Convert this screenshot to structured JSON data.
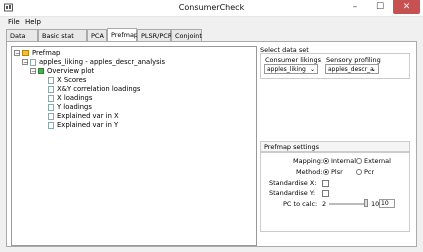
{
  "window": {
    "title": "ConsumerCheck",
    "minimize": "–",
    "maximize": "☐",
    "close": "✕"
  },
  "menu": [
    "File",
    "Help"
  ],
  "tabs": [
    {
      "label": "Data sets"
    },
    {
      "label": "Basic stat liking"
    },
    {
      "label": "PCA"
    },
    {
      "label": "Prefmap",
      "active": true
    },
    {
      "label": "PLSR/PCR"
    },
    {
      "label": "Conjoint"
    }
  ],
  "tree": {
    "root": "Prefmap",
    "dataset": "apples_liking - apples_descr_analysis",
    "overview": "Overview plot",
    "items": [
      "X Scores",
      "X&Y correlation loadings",
      "X loadings",
      "Y loadings",
      "Explained var in X",
      "Explained var in Y"
    ]
  },
  "select_data": {
    "title": "Select data set",
    "consumer_label": "Consumer likings",
    "consumer_value": "apples_liking",
    "sensory_label": "Sensory profiling",
    "sensory_value": "apples_descr_a"
  },
  "settings": {
    "title": "Prefmap settings",
    "mapping_label": "Mapping:",
    "mapping_options": [
      "Internal",
      "External"
    ],
    "method_label": "Method:",
    "method_options": [
      "Plsr",
      "Pcr"
    ],
    "standardise_x": "Standardise X:",
    "standardise_y": "Standardise Y:",
    "pc_label": "PC to calc:",
    "pc_min": "2",
    "pc_max": "10",
    "pc_value": "10"
  },
  "colors": {
    "accent": "#c75050",
    "folder": "#f0c040"
  }
}
